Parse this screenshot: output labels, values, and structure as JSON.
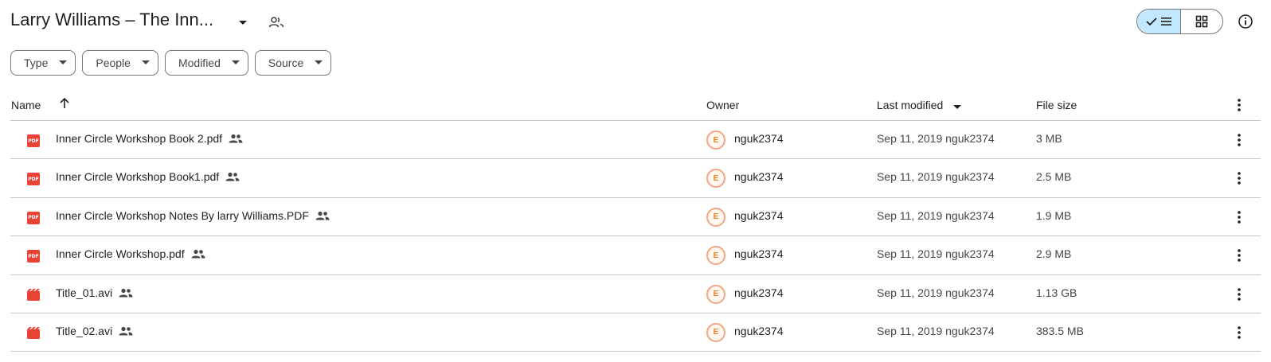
{
  "header": {
    "title": "Larry Williams – The Inn...",
    "caret_icon": "arrow-drop-down-icon",
    "shared_icon": "people-outline-icon"
  },
  "view_toggle": {
    "selected": "list",
    "list_icons": [
      "check-icon",
      "list-icon"
    ],
    "grid_icon": "grid-icon",
    "accent": "#c2e7ff"
  },
  "info_icon": "info-icon",
  "filters": [
    {
      "label": "Type"
    },
    {
      "label": "People"
    },
    {
      "label": "Modified"
    },
    {
      "label": "Source"
    }
  ],
  "table": {
    "columns": {
      "name": "Name",
      "owner": "Owner",
      "last_modified": "Last modified",
      "file_size": "File size"
    },
    "sort": {
      "column": "last_modified",
      "direction": "descending"
    },
    "rows": [
      {
        "name": "Inner Circle Workshop Book 2.pdf",
        "type": "pdf",
        "owner": "nguk2374",
        "modified": "Sep 11, 2019 nguk2374",
        "size": "3 MB"
      },
      {
        "name": "Inner Circle Workshop Book1.pdf",
        "type": "pdf",
        "owner": "nguk2374",
        "modified": "Sep 11, 2019 nguk2374",
        "size": "2.5 MB"
      },
      {
        "name": "Inner Circle Workshop Notes By larry Williams.PDF",
        "type": "pdf",
        "owner": "nguk2374",
        "modified": "Sep 11, 2019 nguk2374",
        "size": "1.9 MB"
      },
      {
        "name": "Inner Circle Workshop.pdf",
        "type": "pdf",
        "owner": "nguk2374",
        "modified": "Sep 11, 2019 nguk2374",
        "size": "2.9 MB"
      },
      {
        "name": "Title_01.avi",
        "type": "video",
        "owner": "nguk2374",
        "modified": "Sep 11, 2019 nguk2374",
        "size": "1.13 GB"
      },
      {
        "name": "Title_02.avi",
        "type": "video",
        "owner": "nguk2374",
        "modified": "Sep 11, 2019 nguk2374",
        "size": "383.5 MB"
      }
    ]
  },
  "colors": {
    "file_icon_red": "#ea4335",
    "border": "#747775",
    "divider": "#c4c7c5"
  }
}
